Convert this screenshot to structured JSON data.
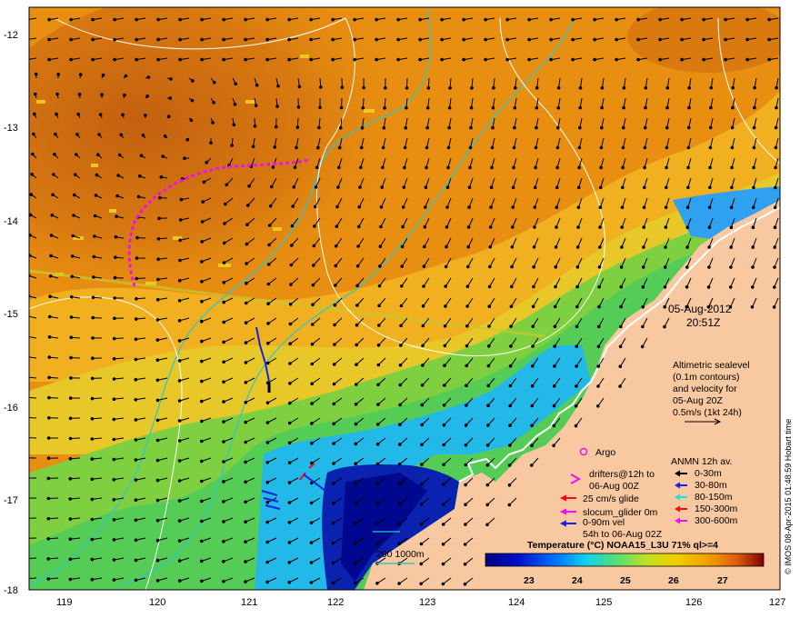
{
  "map": {
    "date": "05-Aug-2012",
    "time": "20:51Z",
    "lat_ticks": [
      "-12",
      "-13",
      "-14",
      "-15",
      "-16",
      "-17",
      "-18"
    ],
    "lon_ticks": [
      "119",
      "120",
      "121",
      "122",
      "123",
      "124",
      "125",
      "126",
      "127"
    ],
    "altimetry": {
      "line1": "Altimetric sealevel",
      "line2": "(0.1m contours)",
      "line3": "and velocity for",
      "line4": "05-Aug 20Z",
      "line5": "0.5m/s (1kt 24h)"
    },
    "legend": {
      "argo": "Argo",
      "drifters_line1": "drifters@12h to",
      "drifters_line2": "06-Aug 00Z",
      "glide": "25 cm/s glide",
      "slocum": "slocum_glider 0m",
      "vel_line1": "0-90m vel",
      "vel_line2": "54h to 06-Aug 02Z",
      "anmn_title": "ANMN 12h av.",
      "anmn_items": [
        "0-30m",
        "30-80m",
        "80-150m",
        "150-300m",
        "300-600m"
      ],
      "anmn_colors": [
        "#000000",
        "#1a22dd",
        "#22dddd",
        "#ee1111",
        "#ee11ee"
      ],
      "isobath": "200  1000m"
    },
    "colorbar": {
      "title": "Temperature (°C) NOAA15_L3U 71% ql>=4",
      "ticks": [
        "23",
        "24",
        "25",
        "26",
        "27"
      ]
    },
    "credit": "© IMOS 08-Apr-2015 01:48:59 Hobart time",
    "colors": {
      "land": "#f8c8a0",
      "warm": "#e08a10",
      "hot": "#c86a10",
      "mid": "#f0c020",
      "green": "#66d040",
      "cyan": "#20b8ee",
      "deep": "#1020a0",
      "isobath": "#30c8c8"
    }
  }
}
